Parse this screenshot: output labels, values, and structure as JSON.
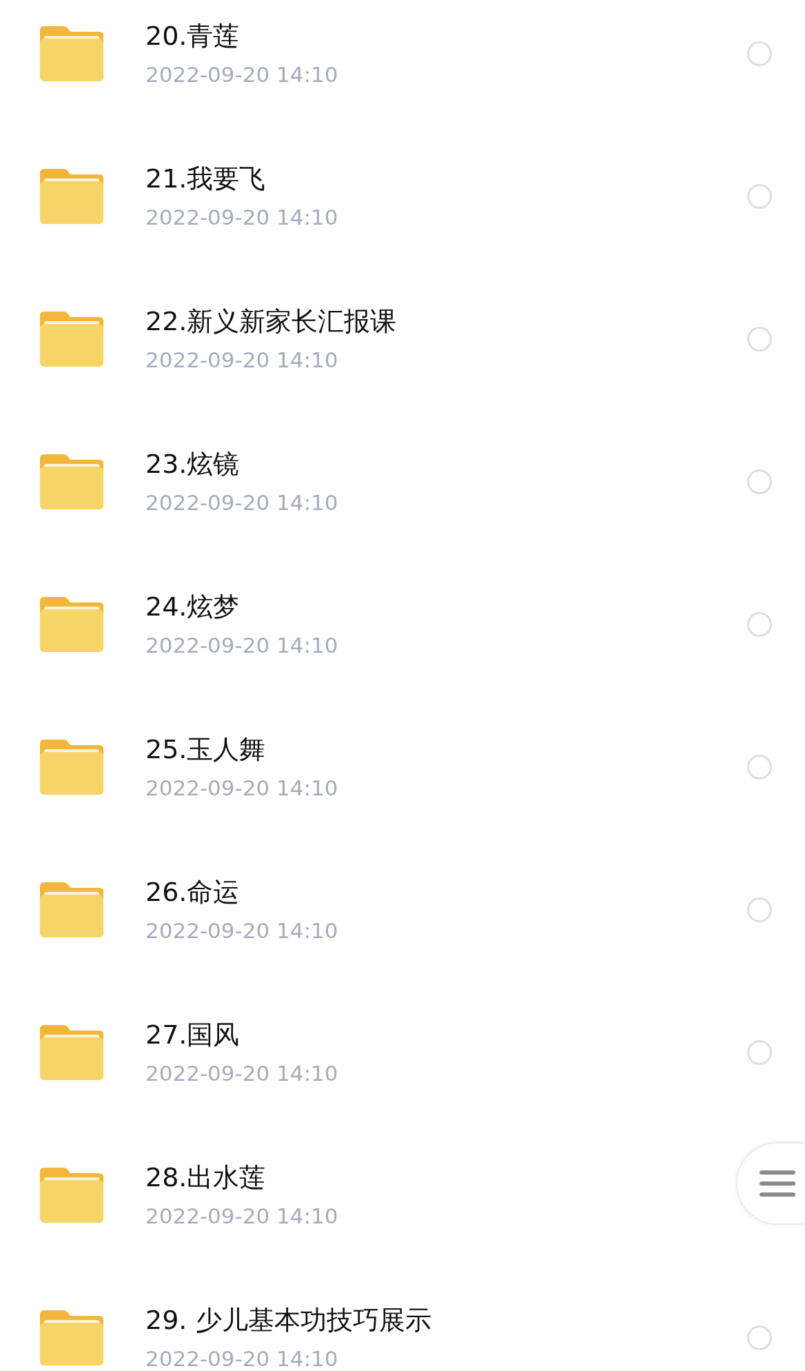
{
  "files": [
    {
      "title": "20.青莲",
      "date": "2022-09-20 14:10",
      "selected": false
    },
    {
      "title": "21.我要飞",
      "date": "2022-09-20 14:10",
      "selected": false
    },
    {
      "title": "22.新义新家长汇报课",
      "date": "2022-09-20 14:10",
      "selected": false
    },
    {
      "title": "23.炫镜",
      "date": "2022-09-20 14:10",
      "selected": false
    },
    {
      "title": "24.炫梦",
      "date": "2022-09-20 14:10",
      "selected": false
    },
    {
      "title": "25.玉人舞",
      "date": "2022-09-20 14:10",
      "selected": false
    },
    {
      "title": "26.命运",
      "date": "2022-09-20 14:10",
      "selected": false
    },
    {
      "title": "27.国风",
      "date": "2022-09-20 14:10",
      "selected": false
    },
    {
      "title": "28.出水莲",
      "date": "2022-09-20 14:10"
    },
    {
      "title": "29. 少儿基本功技巧展示",
      "date": "2022-09-20 14:10",
      "selected": false
    }
  ]
}
